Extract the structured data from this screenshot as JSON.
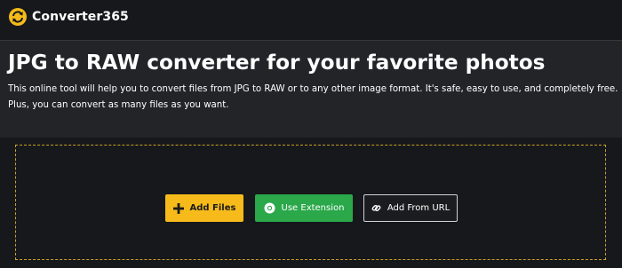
{
  "header": {
    "brand": "Converter365",
    "logo_icon": "refresh-arrows-icon",
    "logo_color": "#f6bb1a"
  },
  "main": {
    "title": "JPG to RAW converter for your favorite photos",
    "description": "This online tool will help you to convert files from JPG to RAW or to any other image format. It's safe, easy to use, and completely free. Plus, you can convert as many files as you want."
  },
  "upload": {
    "add_files_label": "Add Files",
    "add_files_icon": "plus-icon",
    "use_extension_label": "Use Extension",
    "use_extension_icon": "chrome-icon",
    "add_from_url_label": "Add From URL",
    "add_from_url_icon": "link-icon",
    "colors": {
      "add_files_bg": "#f6bb1a",
      "use_extension_bg": "#2aa84a",
      "dropzone_border": "#c9a128"
    }
  }
}
